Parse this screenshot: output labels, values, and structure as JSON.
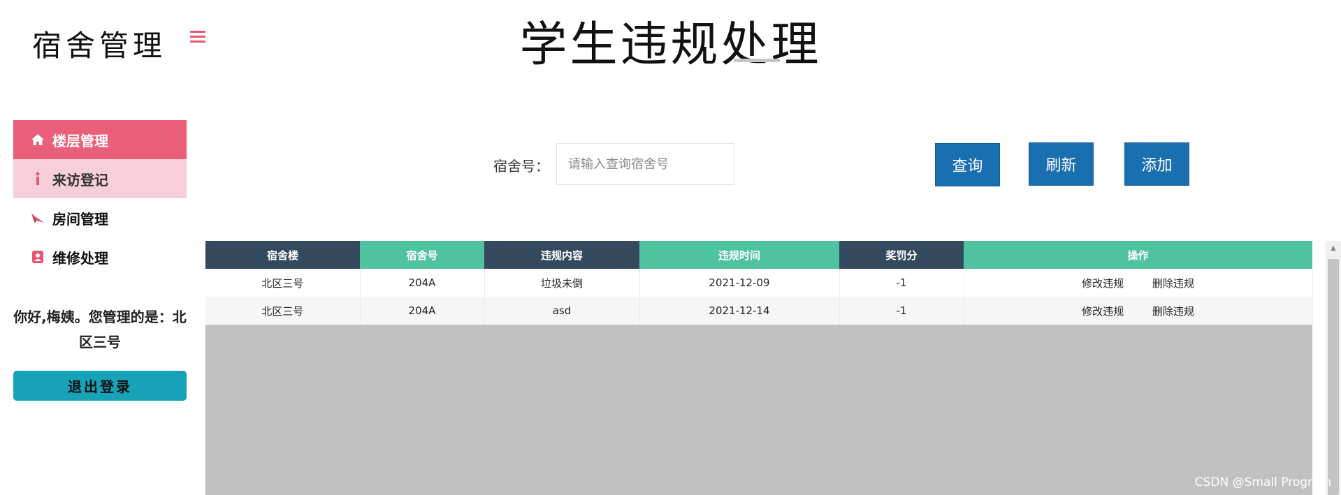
{
  "header": {
    "logo": "宿舍管理",
    "page_title": "学生违规处理"
  },
  "sidebar": {
    "items": [
      {
        "label": "楼层管理",
        "icon": "home-icon"
      },
      {
        "label": "来访登记",
        "icon": "info-icon"
      },
      {
        "label": "房间管理",
        "icon": "paper-plane-icon"
      },
      {
        "label": "维修处理",
        "icon": "contact-card-icon"
      }
    ]
  },
  "user": {
    "greeting": "你好,梅姨。您管理的是：北区三号",
    "logout_label": "退出登录"
  },
  "search": {
    "label": "宿舍号：",
    "placeholder": "请输入查询宿舍号",
    "query_label": "查询",
    "refresh_label": "刷新",
    "add_label": "添加"
  },
  "table": {
    "headers": [
      "宿舍楼",
      "宿舍号",
      "违规内容",
      "违规时间",
      "奖罚分",
      "操作"
    ],
    "rows": [
      {
        "building": "北区三号",
        "room": "204A",
        "content": "垃圾未倒",
        "time": "2021-12-09",
        "score": "-1",
        "edit": "修改违规",
        "delete": "删除违规"
      },
      {
        "building": "北区三号",
        "room": "204A",
        "content": "asd",
        "time": "2021-12-14",
        "score": "-1",
        "edit": "修改违规",
        "delete": "删除违规"
      }
    ]
  },
  "watermark": "CSDN @Small Program",
  "colors": {
    "accent_pink": "#ea5f79",
    "light_pink": "#f7cfd8",
    "header_dark": "#34495e",
    "header_teal": "#4fc29f",
    "button_blue": "#1a6fb0",
    "logout_teal": "#17a2b8"
  }
}
